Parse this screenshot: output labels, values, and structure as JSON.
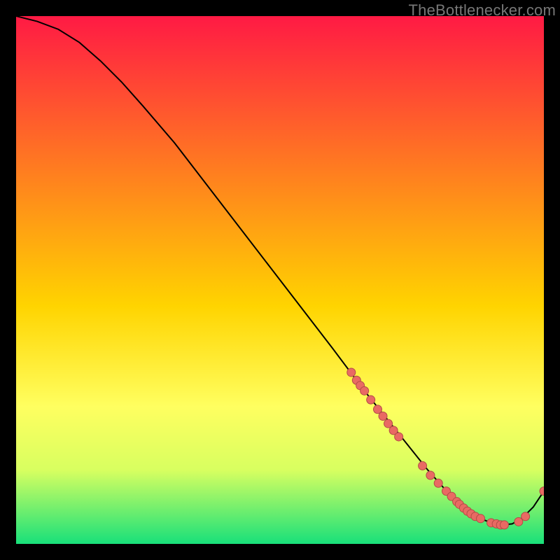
{
  "watermark": "TheBottlenecker.com",
  "colors": {
    "gradient_top": "#ff1a44",
    "gradient_mid": "#ffd400",
    "gradient_low": "#ffff60",
    "gradient_bottom": "#18e07a",
    "frame_bg": "#000000",
    "curve": "#000000",
    "point_fill": "#e96a63",
    "point_stroke": "#b24c46"
  },
  "chart_data": {
    "type": "line",
    "title": "",
    "xlabel": "",
    "ylabel": "",
    "xlim": [
      0,
      100
    ],
    "ylim": [
      0,
      100
    ],
    "series": [
      {
        "name": "curve",
        "x": [
          0,
          4,
          8,
          12,
          16,
          20,
          24,
          30,
          40,
          50,
          60,
          66,
          70,
          74,
          78,
          82,
          86,
          88,
          90,
          92,
          94,
          96,
          98,
          100
        ],
        "y": [
          100,
          99,
          97.5,
          95,
          91.5,
          87.5,
          83,
          76,
          63,
          50,
          37,
          29,
          24,
          19,
          14,
          9.5,
          6,
          4.8,
          4,
          3.6,
          3.8,
          5,
          7,
          10
        ]
      }
    ],
    "points": {
      "name": "markers",
      "x": [
        63.5,
        64.5,
        65.2,
        66.0,
        67.2,
        68.5,
        69.5,
        70.5,
        71.5,
        72.5,
        77.0,
        78.5,
        80.0,
        81.5,
        82.5,
        83.5,
        84.0,
        84.8,
        85.5,
        86.2,
        87.0,
        88.0,
        90.0,
        91.0,
        91.8,
        92.5,
        95.2,
        96.5,
        100.0
      ],
      "y": [
        32.5,
        31.0,
        30.0,
        29.0,
        27.3,
        25.5,
        24.2,
        22.8,
        21.5,
        20.3,
        14.8,
        13.0,
        11.5,
        10.0,
        9.0,
        8.0,
        7.5,
        6.8,
        6.2,
        5.7,
        5.2,
        4.8,
        4.0,
        3.8,
        3.6,
        3.6,
        4.2,
        5.2,
        10.0
      ]
    }
  }
}
